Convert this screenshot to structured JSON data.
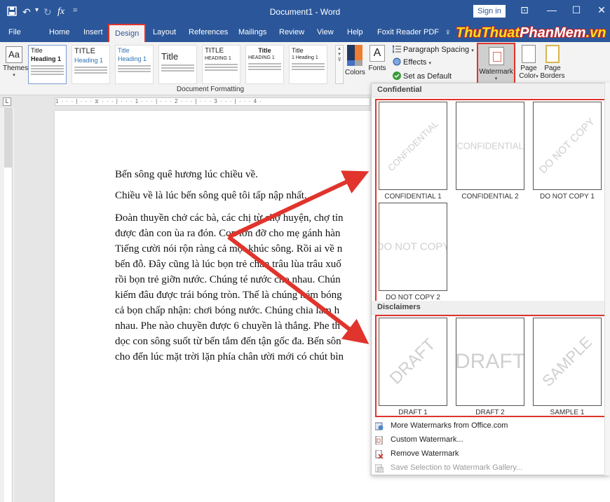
{
  "titlebar": {
    "save_icon": "save-icon",
    "undo_icon": "undo-icon",
    "redo_icon": "redo-icon",
    "fx_icon": "fx-icon",
    "doc_title": "Document1  -  Word",
    "signin": "Sign in",
    "minimize": "—",
    "maximize": "☐",
    "close": "✕",
    "ribbon_opt": "⊡",
    "qa_more": "="
  },
  "brand": {
    "part1": "ThuThuat",
    "part2": "PhanMem",
    "part3": ".vn"
  },
  "tabs": {
    "file": "File",
    "home": "Home",
    "insert": "Insert",
    "design": "Design",
    "layout": "Layout",
    "references": "References",
    "mailings": "Mailings",
    "review": "Review",
    "view": "View",
    "help": "Help",
    "foxit": "Foxit Reader PDF",
    "tellme": "♀"
  },
  "ribbon": {
    "themes": "Themes",
    "themes_glyph": "Aa",
    "style_thumbs": [
      {
        "title": "Title",
        "sub": "Heading 1"
      },
      {
        "title": "TITLE",
        "sub": "Heading 1"
      },
      {
        "title": "Title",
        "sub": "Heading 1"
      },
      {
        "title": "Title",
        "sub": ""
      },
      {
        "title": "TITLE",
        "sub": "HEADING 1"
      },
      {
        "title": "Title",
        "sub": "HEADING 1"
      },
      {
        "title": "Title",
        "sub": "1  Heading 1"
      }
    ],
    "document_formatting": "Document Formatting",
    "colors": "Colors",
    "fonts": "Fonts",
    "fonts_glyph": "A",
    "paragraph_spacing": "Paragraph Spacing",
    "effects": "Effects",
    "set_default": "Set as Default",
    "watermark": "Watermark",
    "page_color_1": "Page",
    "page_color_2": "Color",
    "page_borders_1": "Page",
    "page_borders_2": "Borders"
  },
  "ruler": {
    "corner": "L",
    "marks": "1 · · · | · · · ⧖ · · · | · · · 1 · · · | · · · 2 · · · | · · · 3 · · · | · · · 4 ·"
  },
  "document": {
    "paragraphs": [
      {
        "lines": [
          "Bến sông quê hương lúc chiều về."
        ]
      },
      {
        "lines": [
          "Chiều về là lúc bến sông quê tôi tấp nập nhất."
        ]
      },
      {
        "lines": [
          "Đoàn thuyền chở các bà, các chị từ chợ huyện, chợ tỉn",
          "được đàn con ùa ra đón. Con lớn đỡ cho mẹ gánh hàn",
          "Tiếng cười nói rộn ràng cả một khúc sông. Rồi ai về n",
          "bến đỗ. Đây cũng là lúc bọn trẻ chăn trâu lùa trâu xuố",
          "rồi bọn trẻ giỡn nước. Chúng té nước cho nhau. Chún",
          "kiếm đâu được trái bóng tròn. Thế là chúng ném bóng",
          "cả bọn chấp nhận: chơi bóng nước. Chúng chia làm h",
          "nhau. Phe nào chuyền được 6 chuyền là thắng. Phe th",
          "dọc con sông suốt từ bến tắm đến tận gốc đa. Bến sôn",
          "cho đến lúc mặt trời lặn phía chân ười mới có chút bìn"
        ]
      }
    ]
  },
  "watermark_menu": {
    "confidential_header": "Confidential",
    "disclaimers_header": "Disclaimers",
    "confidential_items": [
      {
        "label": "CONFIDENTIAL 1",
        "mark": "CONFIDENTIAL"
      },
      {
        "label": "CONFIDENTIAL 2",
        "mark": "CONFIDENTIAL"
      },
      {
        "label": "DO NOT COPY 1",
        "mark": "DO NOT COPY"
      },
      {
        "label": "DO NOT COPY 2",
        "mark": "DO NOT COPY"
      }
    ],
    "disclaimer_items": [
      {
        "label": "DRAFT 1",
        "mark": "DRAFT"
      },
      {
        "label": "DRAFT 2",
        "mark": "DRAFT"
      },
      {
        "label": "SAMPLE 1",
        "mark": "SAMPLE"
      }
    ],
    "more_watermarks": "More Watermarks from Office.com",
    "custom_watermark": "Custom Watermark...",
    "remove_watermark": "Remove Watermark",
    "save_selection": "Save Selection to Watermark Gallery..."
  },
  "colors": {
    "title_bar": "#2b579a",
    "highlight_red": "#e0342c",
    "brand_yellow": "#f7e11b"
  }
}
